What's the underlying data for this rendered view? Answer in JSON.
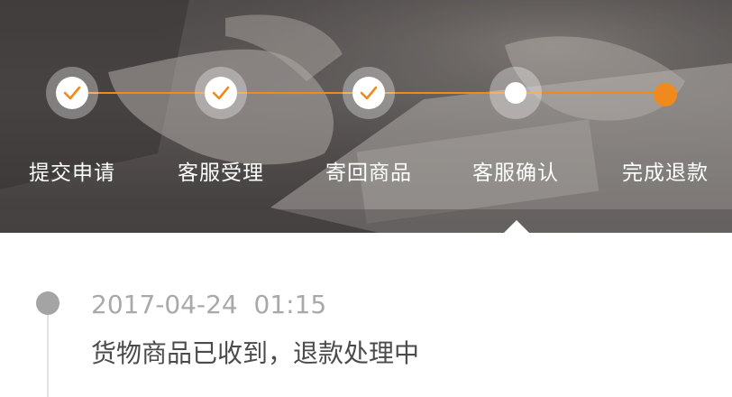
{
  "progress": {
    "accent_color": "#f08a1c",
    "steps": [
      {
        "label": "提交申请",
        "state": "done",
        "icon": "check-icon"
      },
      {
        "label": "客服受理",
        "state": "done",
        "icon": "check-icon"
      },
      {
        "label": "寄回商品",
        "state": "done",
        "icon": "check-icon"
      },
      {
        "label": "客服确认",
        "state": "current",
        "icon": "dot-icon"
      },
      {
        "label": "完成退款",
        "state": "pending",
        "icon": "dot-icon"
      }
    ]
  },
  "log": {
    "entries": [
      {
        "time": "2017-04-24  01:15",
        "text": "货物商品已收到，退款处理中"
      }
    ]
  }
}
